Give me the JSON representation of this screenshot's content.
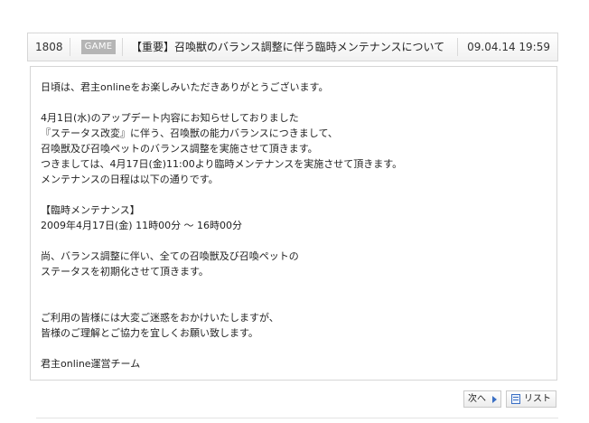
{
  "header": {
    "number": "1808",
    "category": "GAME",
    "title": "【重要】召喚獣のバランス調整に伴う臨時メンテナンスについて",
    "date": "09.04.14 19:59"
  },
  "body": {
    "lines": [
      "日頃は、君主onlineをお楽しみいただきありがとうございます。",
      "",
      "4月1日(水)のアップデート内容にお知らせしておりました",
      "『ステータス改変』に伴う、召喚獣の能力バランスにつきまして、",
      "召喚獣及び召喚ペットのバランス調整を実施させて頂きます。",
      "つきましては、4月17日(金)11:00より臨時メンテナンスを実施させて頂きます。",
      "メンテナンスの日程は以下の通りです。",
      "",
      "【臨時メンテナンス】",
      "2009年4月17日(金) 11時00分 ～ 16時00分",
      "",
      "尚、バランス調整に伴い、全ての召喚獣及び召喚ペットの",
      "ステータスを初期化させて頂きます。",
      "",
      "",
      "ご利用の皆様には大変ご迷惑をおかけいたしますが、",
      "皆様のご理解とご協力を宜しくお願い致します。",
      "",
      "君主online運営チーム"
    ]
  },
  "buttons": {
    "next_label": "次へ",
    "list_label": "リスト"
  },
  "icons": {
    "next": "triangle-right-icon",
    "list": "list-document-icon"
  },
  "colors": {
    "category_badge_bg": "#b5b5b5",
    "icon_accent": "#3a6fc4",
    "border": "#d6d6d6"
  }
}
